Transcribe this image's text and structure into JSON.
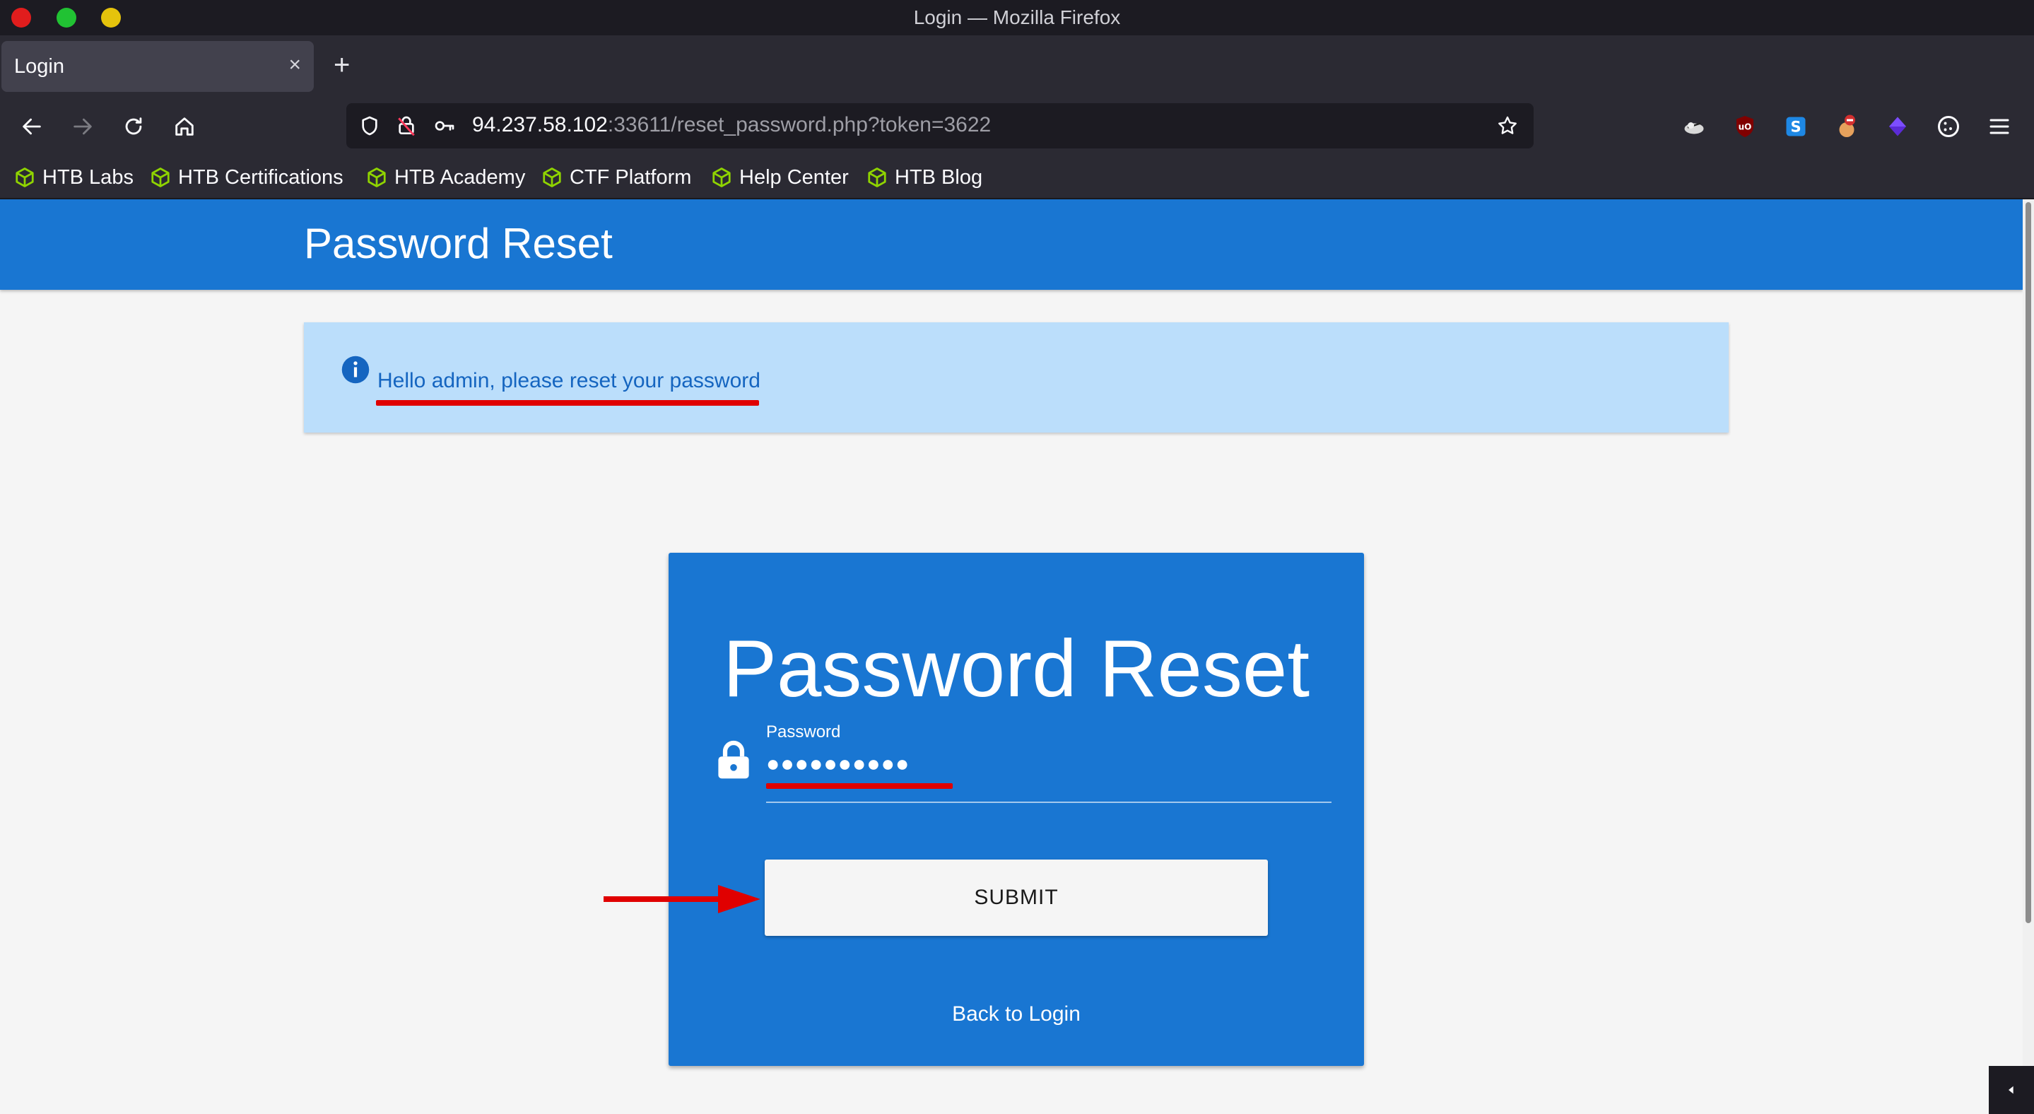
{
  "window": {
    "title": "Login — Mozilla Firefox"
  },
  "tab": {
    "title": "Login",
    "close": "×",
    "new_tab": "+"
  },
  "urlbar": {
    "host": "94.237.58.102",
    "rest": ":33611/reset_password.php?token=3622"
  },
  "bookmarks": [
    {
      "label": "HTB Labs"
    },
    {
      "label": "HTB Certifications"
    },
    {
      "label": "HTB Academy"
    },
    {
      "label": "CTF Platform"
    },
    {
      "label": "Help Center"
    },
    {
      "label": "HTB Blog"
    }
  ],
  "page": {
    "header_title": "Password Reset",
    "alert_text": "Hello admin, please reset your password",
    "card": {
      "title": "Password Reset",
      "password_label": "Password",
      "password_value": "●●●●●●●●●●",
      "submit_label": "SUBMIT",
      "back_link": "Back to Login"
    }
  },
  "colors": {
    "primary": "#1976d2",
    "alert_bg": "#bbdefb",
    "annotation_red": "#e00000",
    "bookmark_icon": "#8fd400"
  },
  "icons": {
    "nav": [
      "back-arrow-icon",
      "forward-arrow-icon",
      "reload-icon",
      "home-icon"
    ],
    "url": [
      "shield-icon",
      "insecure-lock-icon",
      "key-icon",
      "star-icon"
    ],
    "extensions": [
      "cloud-extension-icon",
      "ublock-icon",
      "s-extension-icon",
      "fox-extension-icon",
      "purple-diamond-icon",
      "cookie-icon",
      "menu-icon"
    ],
    "bookmark": "hexagon-cube-icon"
  }
}
